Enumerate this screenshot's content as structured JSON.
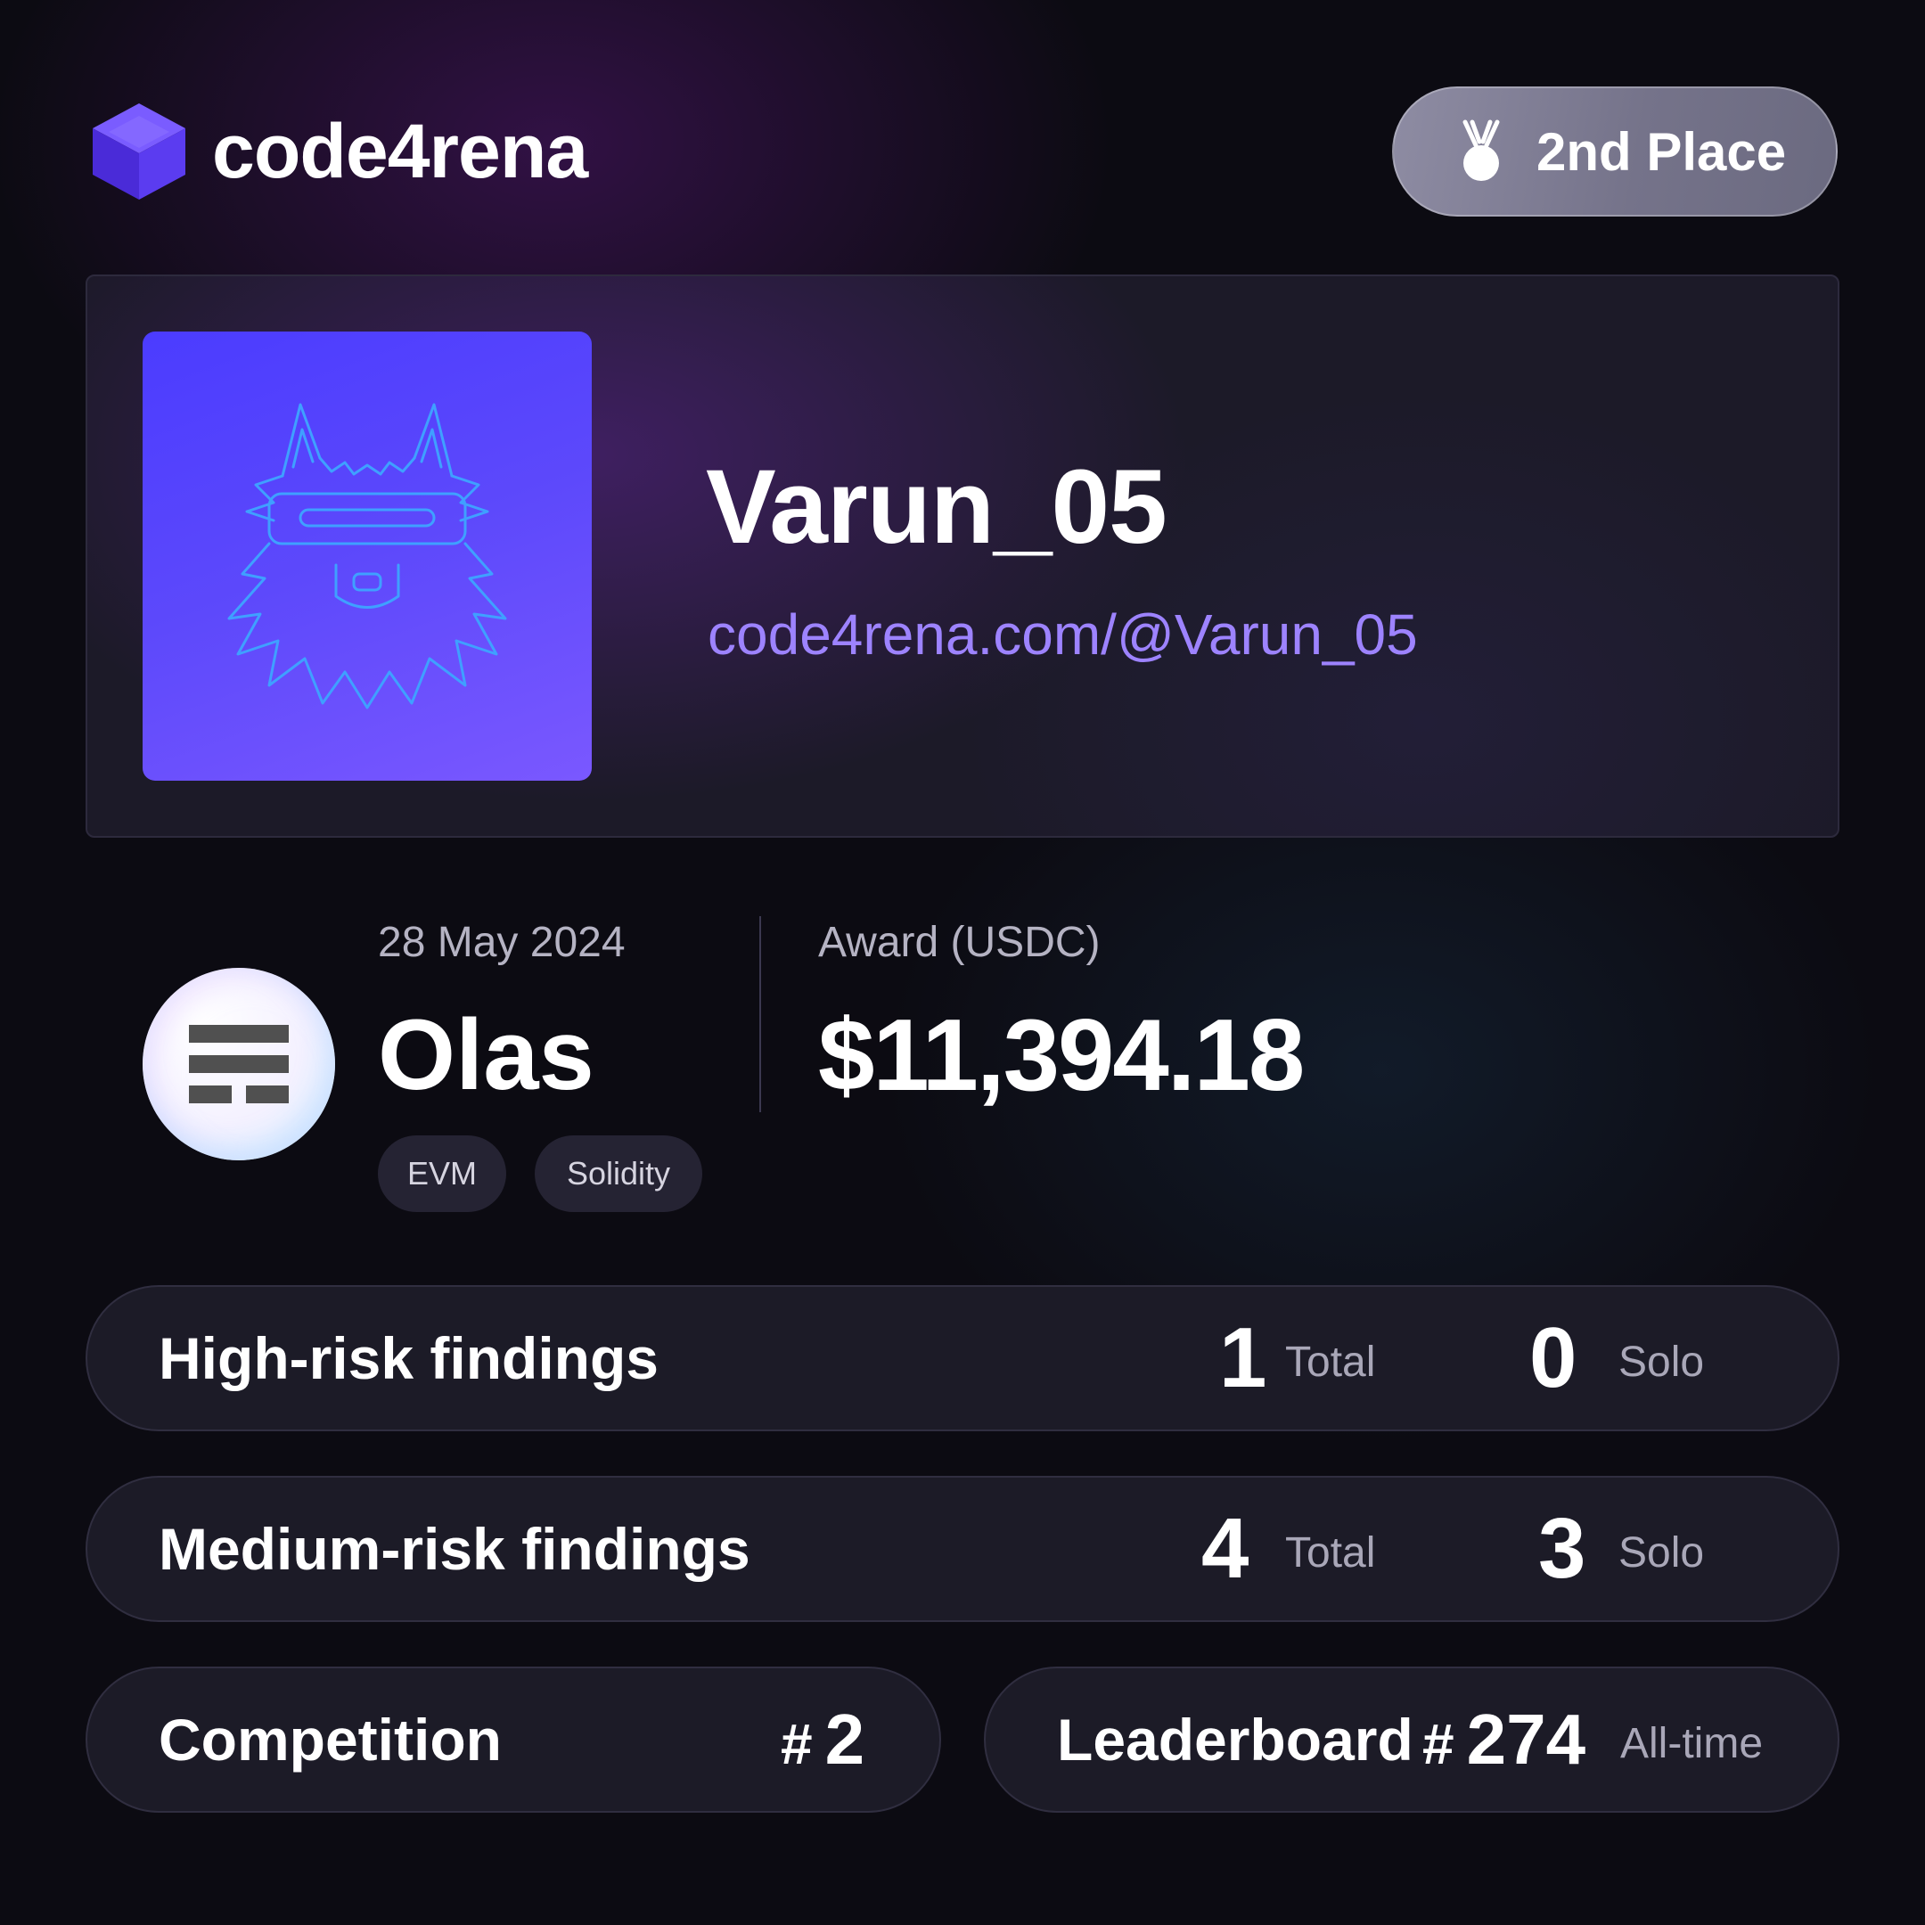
{
  "header": {
    "brand": "code4rena",
    "placement": "2nd Place",
    "placement_icon": "medal-icon"
  },
  "profile": {
    "username": "Varun_05",
    "url": "code4rena.com/@Varun_05",
    "avatar_icon": "wolf-avatar-icon"
  },
  "contest": {
    "date": "28 May 2024",
    "name": "Olas",
    "tags": [
      "EVM",
      "Solidity"
    ],
    "award_label": "Award (USDC)",
    "award_amount": "$11,394.18"
  },
  "stats": {
    "high": {
      "label": "High-risk findings",
      "total": "1",
      "total_label": "Total",
      "solo": "0",
      "solo_label": "Solo"
    },
    "medium": {
      "label": "Medium-risk findings",
      "total": "4",
      "total_label": "Total",
      "solo": "3",
      "solo_label": "Solo"
    },
    "competition": {
      "label": "Competition",
      "hash": "#",
      "rank": "2"
    },
    "leaderboard": {
      "label": "Leaderboard",
      "hash": "#",
      "rank": "274",
      "scope": "All-time"
    }
  },
  "colors": {
    "background": "#0c0b12",
    "accent_purple": "#9d83ff",
    "avatar_bg": "#5d49fb",
    "pill_bg": "#7e7c93"
  }
}
